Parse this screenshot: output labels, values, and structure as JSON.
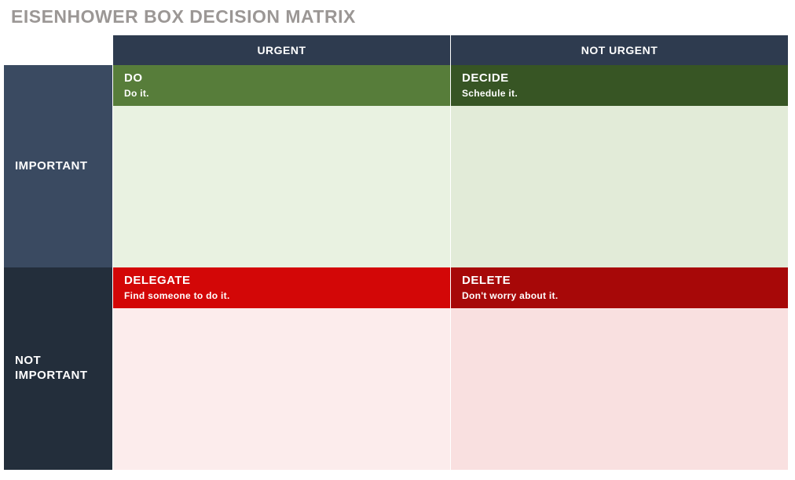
{
  "title": "EISENHOWER BOX DECISION MATRIX",
  "columns": {
    "urgent": "URGENT",
    "not_urgent": "NOT URGENT"
  },
  "rows": {
    "important": "IMPORTANT",
    "not_important": "NOT\nIMPORTANT"
  },
  "quadrants": {
    "do": {
      "title": "DO",
      "subtitle": "Do it."
    },
    "decide": {
      "title": "DECIDE",
      "subtitle": "Schedule it."
    },
    "delegate": {
      "title": "DELEGATE",
      "subtitle": "Find someone to do it."
    },
    "delete": {
      "title": "DELETE",
      "subtitle": "Don't worry about it."
    }
  }
}
